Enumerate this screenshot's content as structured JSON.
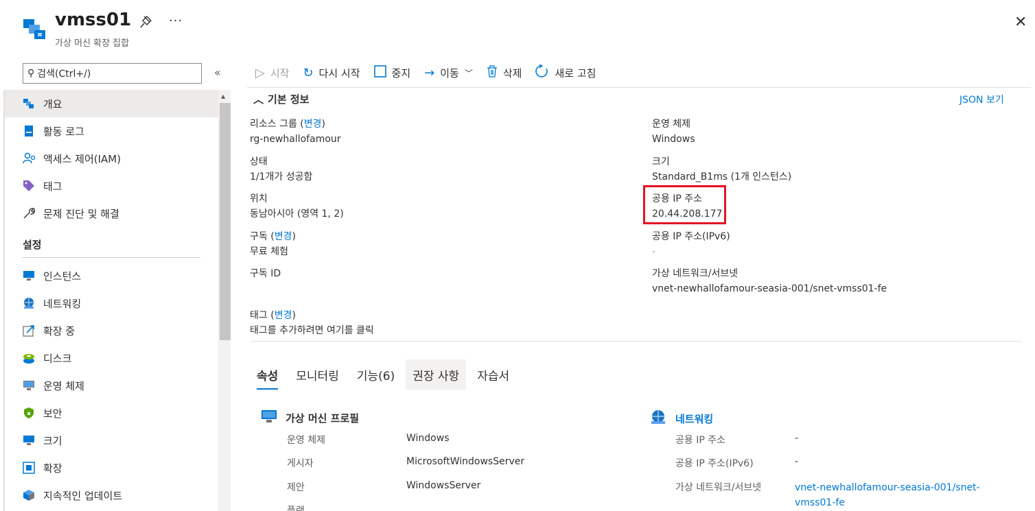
{
  "header": {
    "title": "vmss01",
    "subtitle": "가상 머신 확장 집합",
    "more": "···",
    "close": "✕"
  },
  "search": {
    "placeholder": "검색(Ctrl+/)"
  },
  "sidebar": {
    "items": [
      {
        "label": "개요",
        "icon": "overview-icon"
      },
      {
        "label": "활동 로그",
        "icon": "activity-log-icon"
      },
      {
        "label": "액세스 제어(IAM)",
        "icon": "iam-icon"
      },
      {
        "label": "태그",
        "icon": "tag-icon"
      },
      {
        "label": "문제 진단 및 해결",
        "icon": "wrench-icon"
      }
    ],
    "section_title": "설정",
    "settings_items": [
      {
        "label": "인스턴스",
        "icon": "instances-icon"
      },
      {
        "label": "네트워킹",
        "icon": "networking-icon"
      },
      {
        "label": "확장 중",
        "icon": "scaling-icon"
      },
      {
        "label": "디스크",
        "icon": "disk-icon"
      },
      {
        "label": "운영 체제",
        "icon": "os-icon"
      },
      {
        "label": "보안",
        "icon": "security-icon"
      },
      {
        "label": "크기",
        "icon": "size-icon"
      },
      {
        "label": "확장",
        "icon": "extensions-icon"
      },
      {
        "label": "지속적인 업데이트",
        "icon": "continuous-update-icon"
      }
    ]
  },
  "toolbar": {
    "start": "시작",
    "restart": "다시 시작",
    "stop": "중지",
    "move": "이동",
    "delete": "삭제",
    "refresh": "새로 고침"
  },
  "essentials": {
    "heading": "기본 정보",
    "json_view": "JSON 보기",
    "change": "변경",
    "resource_group_label": "리소스 그룹",
    "resource_group_value": "rg-newhallofamour",
    "status_label": "상태",
    "status_value": "1/1개가 성공함",
    "location_label": "위치",
    "location_value": "동남아시아 (영역 1, 2)",
    "subscription_label": "구독",
    "subscription_value": "무료 체험",
    "subscription_id_label": "구독 ID",
    "os_label": "운영 체제",
    "os_value": "Windows",
    "size_label": "크기",
    "size_value": "Standard_B1ms (1개 인스턴스)",
    "public_ip_label": "공용 IP 주소",
    "public_ip_value": "20.44.208.177",
    "public_ipv6_label": "공용 IP 주소(IPv6)",
    "public_ipv6_value": "-",
    "vnet_label": "가상 네트워크/서브넷",
    "vnet_value": "vnet-newhallofamour-seasia-001/snet-vmss01-fe",
    "tags_label": "태그",
    "tags_value": "태그를 추가하려면 여기를 클릭"
  },
  "tabs": [
    "속성",
    "모니터링",
    "기능(6)",
    "권장 사항",
    "자습서"
  ],
  "vm_profile": {
    "title": "가상 머신 프로필",
    "rows": [
      {
        "label": "운영 체제",
        "value": "Windows"
      },
      {
        "label": "게시자",
        "value": "MicrosoftWindowsServer"
      },
      {
        "label": "제안",
        "value": "WindowsServer"
      },
      {
        "label": "플랜",
        "value": ""
      }
    ]
  },
  "networking": {
    "title": "네트워킹",
    "rows": [
      {
        "label": "공용 IP 주소",
        "value": "-"
      },
      {
        "label": "공용 IP 주소(IPv6)",
        "value": "-"
      },
      {
        "label": "가상 네트워크/서브넷",
        "value_line1": "vnet-newhallofamour-seasia-001/snet-",
        "value_line2": "vmss01-fe"
      }
    ]
  },
  "colors": {
    "accent": "#0078d4",
    "highlight": "#e81123",
    "active_bg": "#edebe9"
  }
}
